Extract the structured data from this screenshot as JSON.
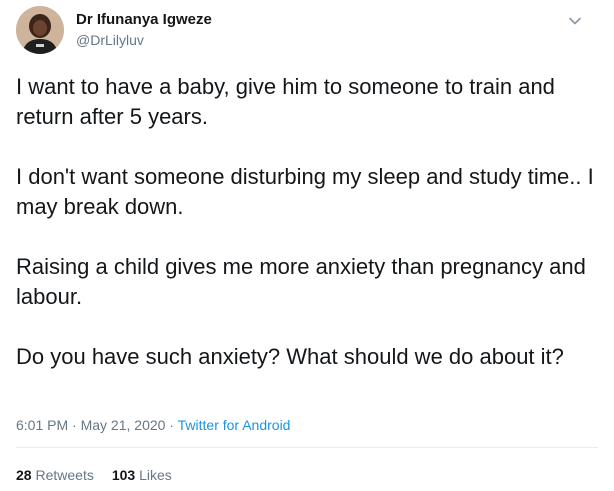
{
  "author": {
    "name": "Dr Ifunanya Igweze",
    "handle": "@DrLilyluv",
    "avatar_icon": "profile-photo",
    "menu_icon": "chevron-down-icon"
  },
  "tweet": {
    "paragraphs": [
      "I want to have a baby, give him to someone to train and return after 5 years.",
      "I don't want someone disturbing my sleep and study time.. I may break down.",
      "Raising a child gives me more anxiety than pregnancy and labour.",
      "Do you have such anxiety?  What should we do about it?"
    ],
    "time": "6:01 PM",
    "date": "May 21, 2020",
    "separator": "·",
    "source": "Twitter for Android"
  },
  "stats": {
    "retweets_count": "28",
    "retweets_label": "Retweets",
    "likes_count": "103",
    "likes_label": "Likes"
  },
  "colors": {
    "text": "#14171a",
    "secondary": "#657786",
    "link": "#1b95e0",
    "divider": "#e6ecf0"
  }
}
